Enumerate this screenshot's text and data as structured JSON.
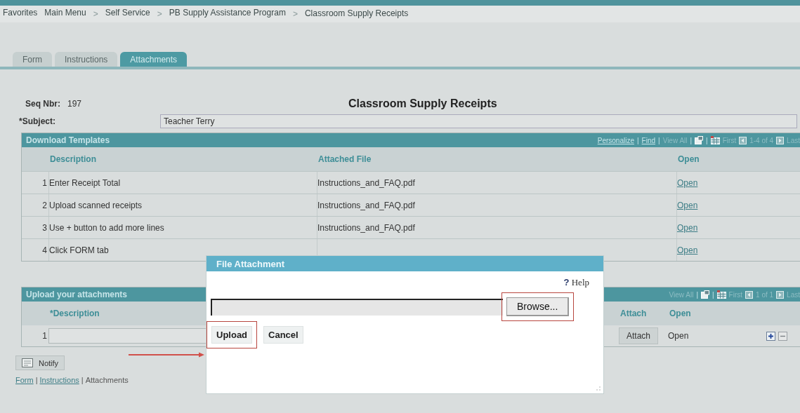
{
  "breadcrumb": [
    {
      "kind": "menu",
      "label": "Favorites"
    },
    {
      "kind": "menu",
      "label": "Main Menu"
    },
    {
      "kind": "separator",
      "label": ">"
    },
    {
      "kind": "menu",
      "label": "Self Service"
    },
    {
      "kind": "separator",
      "label": ">"
    },
    {
      "kind": "menu",
      "label": "PB Supply Assistance Program"
    },
    {
      "kind": "separator",
      "label": ">"
    },
    {
      "kind": "page",
      "label": "Classroom Supply Receipts"
    }
  ],
  "tabs": [
    {
      "label": "Form",
      "selected": false
    },
    {
      "label": "Instructions",
      "selected": false
    },
    {
      "label": "Attachments",
      "selected": true
    }
  ],
  "form": {
    "seq_label": "Seq Nbr:",
    "seq_value": "197",
    "title": "Classroom Supply Receipts",
    "subject_label": "*Subject:",
    "subject_value": "Teacher Terry"
  },
  "download_grid": {
    "title": "Download Templates",
    "nav": [
      {
        "kind": "link",
        "label": "Personalize"
      },
      {
        "kind": "separator",
        "label": "|"
      },
      {
        "kind": "link",
        "label": "Find"
      },
      {
        "kind": "separator",
        "label": "|"
      },
      {
        "kind": "disabled",
        "label": "View All"
      },
      {
        "kind": "separator",
        "label": "|"
      },
      {
        "kind": "zoom"
      },
      {
        "kind": "separator",
        "label": "|"
      },
      {
        "kind": "download"
      },
      {
        "kind": "disabled",
        "label": "First"
      },
      {
        "kind": "prev"
      },
      {
        "kind": "disabled",
        "label": "1-4 of 4"
      },
      {
        "kind": "next"
      },
      {
        "kind": "disabled",
        "label": "Last"
      }
    ],
    "columns": [
      "Description",
      "Attached File",
      "Open"
    ],
    "rows": [
      {
        "number": "1",
        "description": "Enter Receipt Total",
        "file": "Instructions_and_FAQ.pdf",
        "open": "Open"
      },
      {
        "number": "2",
        "description": "Upload scanned receipts",
        "file": "Instructions_and_FAQ.pdf",
        "open": "Open"
      },
      {
        "number": "3",
        "description": "Use + button to add more lines",
        "file": "Instructions_and_FAQ.pdf",
        "open": "Open"
      },
      {
        "number": "4",
        "description": "Click FORM tab",
        "open": "Open"
      }
    ]
  },
  "upload_grid": {
    "title": "Upload your attachments",
    "nav": [
      {
        "kind": "disabled",
        "label": "View All"
      },
      {
        "kind": "separator",
        "label": "|"
      },
      {
        "kind": "zoom"
      },
      {
        "kind": "separator",
        "label": "|"
      },
      {
        "kind": "download"
      },
      {
        "kind": "disabled",
        "label": "First"
      },
      {
        "kind": "prev"
      },
      {
        "kind": "disabled",
        "label": "1 of 1"
      },
      {
        "kind": "next"
      },
      {
        "kind": "disabled",
        "label": "Last"
      }
    ],
    "columns": [
      "*Description",
      "Attach",
      "Open"
    ],
    "rows": [
      {
        "number": "1",
        "attach": "Attach",
        "open": "Open"
      }
    ]
  },
  "notify": {
    "label": "Notify"
  },
  "footer_links": [
    {
      "kind": "link",
      "label": "Form"
    },
    {
      "kind": "separator",
      "label": "|"
    },
    {
      "kind": "link",
      "label": "Instructions"
    },
    {
      "kind": "separator",
      "label": "|"
    },
    {
      "kind": "current",
      "label": "Attachments"
    }
  ],
  "dialog": {
    "title": "File Attachment",
    "help_mark": "?",
    "help": "Help",
    "browse": {
      "label": "Browse...",
      "highlighted": true
    },
    "upload": {
      "label": "Upload",
      "highlighted": true,
      "pointer_arrow": true
    },
    "cancel": {
      "label": "Cancel"
    }
  }
}
